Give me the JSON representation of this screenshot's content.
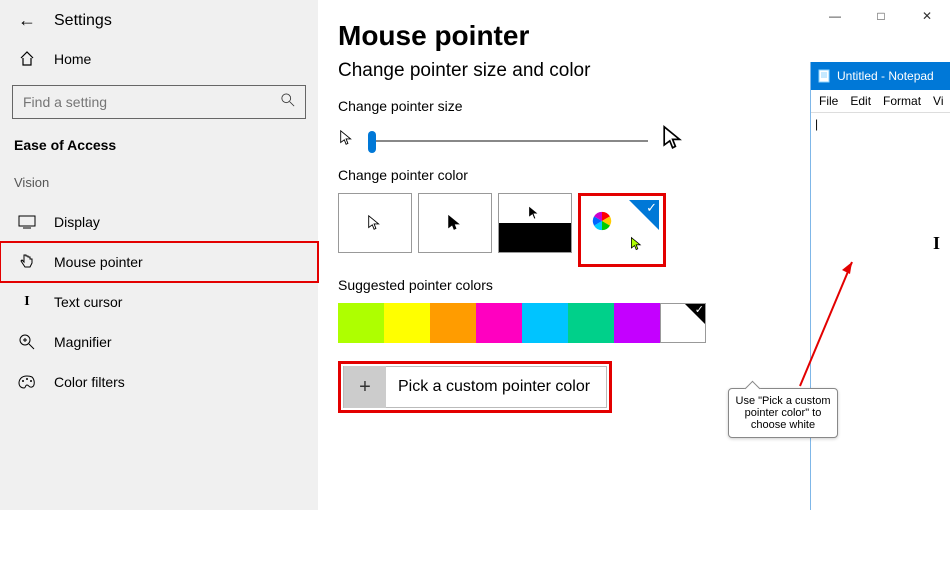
{
  "app_title": "Settings",
  "home_label": "Home",
  "search_placeholder": "Find a setting",
  "section_head": "Ease of Access",
  "section_group": "Vision",
  "nav": {
    "display": "Display",
    "mouse_pointer": "Mouse pointer",
    "text_cursor": "Text cursor",
    "magnifier": "Magnifier",
    "color_filters": "Color filters"
  },
  "page": {
    "title": "Mouse pointer",
    "subtitle": "Change pointer size and color",
    "size_label": "Change pointer size",
    "color_label": "Change pointer color",
    "suggested_label": "Suggested pointer colors",
    "custom_label": "Pick a custom pointer color"
  },
  "suggested_colors": [
    "#aeff00",
    "#ffff00",
    "#ff9c00",
    "#ff00c0",
    "#00c4ff",
    "#00d08a",
    "#c400ff",
    "#ffffff"
  ],
  "notepad": {
    "title": "Untitled - Notepad",
    "menu": [
      "File",
      "Edit",
      "Format",
      "Vi"
    ]
  },
  "callout_text": "Use \"Pick a custom pointer color\" to choose white"
}
